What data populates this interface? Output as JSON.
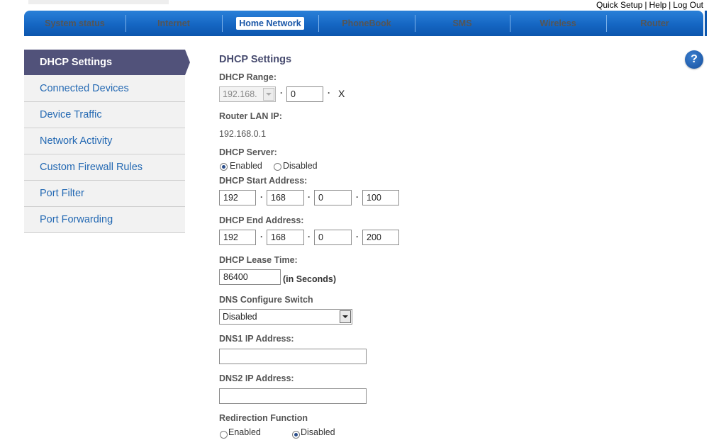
{
  "top_links": {
    "quick_setup": "Quick Setup",
    "sep1": "|",
    "help": "Help",
    "sep2": "|",
    "logout": "Log Out"
  },
  "nav": {
    "items": [
      {
        "label": "System status"
      },
      {
        "label": "Internet"
      },
      {
        "label": "Home Network",
        "active": true
      },
      {
        "label": "PhoneBook"
      },
      {
        "label": "SMS"
      },
      {
        "label": "Wireless"
      },
      {
        "label": "Router"
      }
    ]
  },
  "sidebar": {
    "items": [
      {
        "label": "DHCP Settings",
        "active": true
      },
      {
        "label": "Connected Devices"
      },
      {
        "label": "Device Traffic"
      },
      {
        "label": "Network Activity"
      },
      {
        "label": "Custom Firewall Rules"
      },
      {
        "label": "Port Filter"
      },
      {
        "label": "Port Forwarding"
      }
    ]
  },
  "help_icon": {
    "glyph": "?",
    "icon": "help-icon"
  },
  "form": {
    "title": "DHCP Settings",
    "dhcp_range": {
      "label": "DHCP Range:",
      "prefix": "192.168.",
      "octet3": "0",
      "suffix": "X",
      "dot": "·"
    },
    "router_lan_ip": {
      "label": "Router LAN IP:",
      "value": "192.168.0.1"
    },
    "dhcp_server": {
      "label": "DHCP Server:",
      "enabled_label": "Enabled",
      "disabled_label": "Disabled",
      "selected": "Enabled"
    },
    "start_address": {
      "label": "DHCP Start Address:",
      "octets": [
        "192",
        "168",
        "0",
        "100"
      ]
    },
    "end_address": {
      "label": "DHCP End Address:",
      "octets": [
        "192",
        "168",
        "0",
        "200"
      ]
    },
    "lease_time": {
      "label": "DHCP Lease Time:",
      "value": "86400",
      "unit": "(in Seconds)"
    },
    "dns_switch": {
      "label": "DNS Configure Switch",
      "value": "Disabled"
    },
    "dns1": {
      "label": "DNS1 IP Address:",
      "value": ""
    },
    "dns2": {
      "label": "DNS2 IP Address:",
      "value": ""
    },
    "redirection": {
      "label": "Redirection Function",
      "enabled_label": "Enabled",
      "disabled_label": "Disabled",
      "selected": "Disabled"
    }
  }
}
